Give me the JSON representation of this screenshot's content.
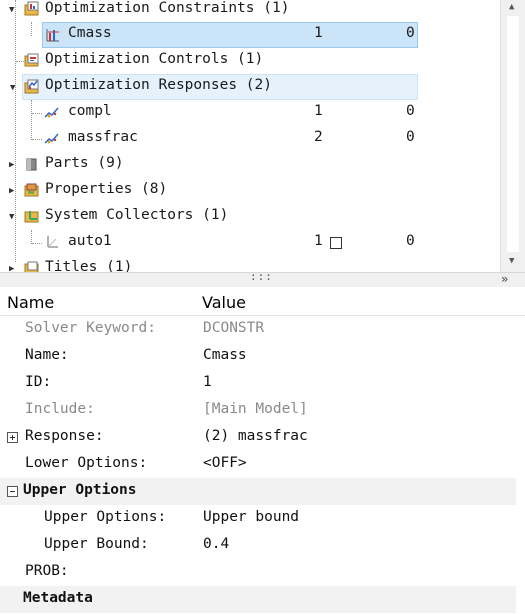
{
  "tree": {
    "rows": [
      {
        "label": "Optimization Constraints (1)"
      },
      {
        "label": "Cmass",
        "col1": "1",
        "col2": "0"
      },
      {
        "label": "Optimization Controls (1)"
      },
      {
        "label": "Optimization Responses (2)"
      },
      {
        "label": "compl",
        "col1": "1",
        "col2": "0"
      },
      {
        "label": "massfrac",
        "col1": "2",
        "col2": "0"
      },
      {
        "label": "Parts (9)"
      },
      {
        "label": "Properties (8)"
      },
      {
        "label": "System Collectors (1)"
      },
      {
        "label": "auto1",
        "col1": "1",
        "col2": "0"
      },
      {
        "label": "Titles (1)"
      }
    ]
  },
  "splitter": {
    "grip": ":::"
  },
  "scrollbar": {
    "up": "▲",
    "down": "▼",
    "collapse": "»"
  },
  "properties": {
    "header_name": "Name",
    "header_value": "Value",
    "rows": [
      {
        "key": "Solver Keyword:",
        "value": "DCONSTR"
      },
      {
        "key": "Name:",
        "value": "Cmass"
      },
      {
        "key": "ID:",
        "value": "1"
      },
      {
        "key": "Include:",
        "value": "[Main Model]"
      },
      {
        "key": "Response:",
        "value": "(2) massfrac"
      },
      {
        "key": "Lower Options:",
        "value": "<OFF>"
      },
      {
        "key": "Upper Options"
      },
      {
        "key": "Upper Options:",
        "value": "Upper bound"
      },
      {
        "key": "Upper Bound:",
        "value": "0.4"
      },
      {
        "key": "PROB:",
        "value": ""
      },
      {
        "key": "Metadata"
      }
    ]
  },
  "colors": {
    "selection": "#cce4f7",
    "hover": "#e5f1fb",
    "section_bg": "#f2f2f2"
  }
}
